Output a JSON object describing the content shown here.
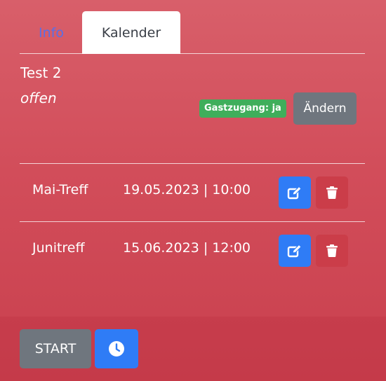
{
  "tabs": [
    {
      "label": "Info",
      "active": false
    },
    {
      "label": "Kalender",
      "active": true
    }
  ],
  "event": {
    "title": "Test 2",
    "status": "offen",
    "guest_badge": "Gastzugang: ja",
    "change_label": "Ändern"
  },
  "entries": [
    {
      "name": "Mai-Treff",
      "datetime": "19.05.2023 | 10:00",
      "edit_icon": "edit-icon",
      "delete_icon": "trash-icon"
    },
    {
      "name": "Junitreff",
      "datetime": "15.06.2023 | 12:00",
      "edit_icon": "edit-icon",
      "delete_icon": "trash-icon"
    }
  ],
  "footer": {
    "start_label": "START",
    "clock_icon": "clock-icon"
  },
  "colors": {
    "background": "#d24d5a",
    "primary": "#2f7cf6",
    "secondary": "#6f767e",
    "success": "#3fae5b",
    "danger": "#cb3d49",
    "tab_link": "#5a6fe6"
  }
}
